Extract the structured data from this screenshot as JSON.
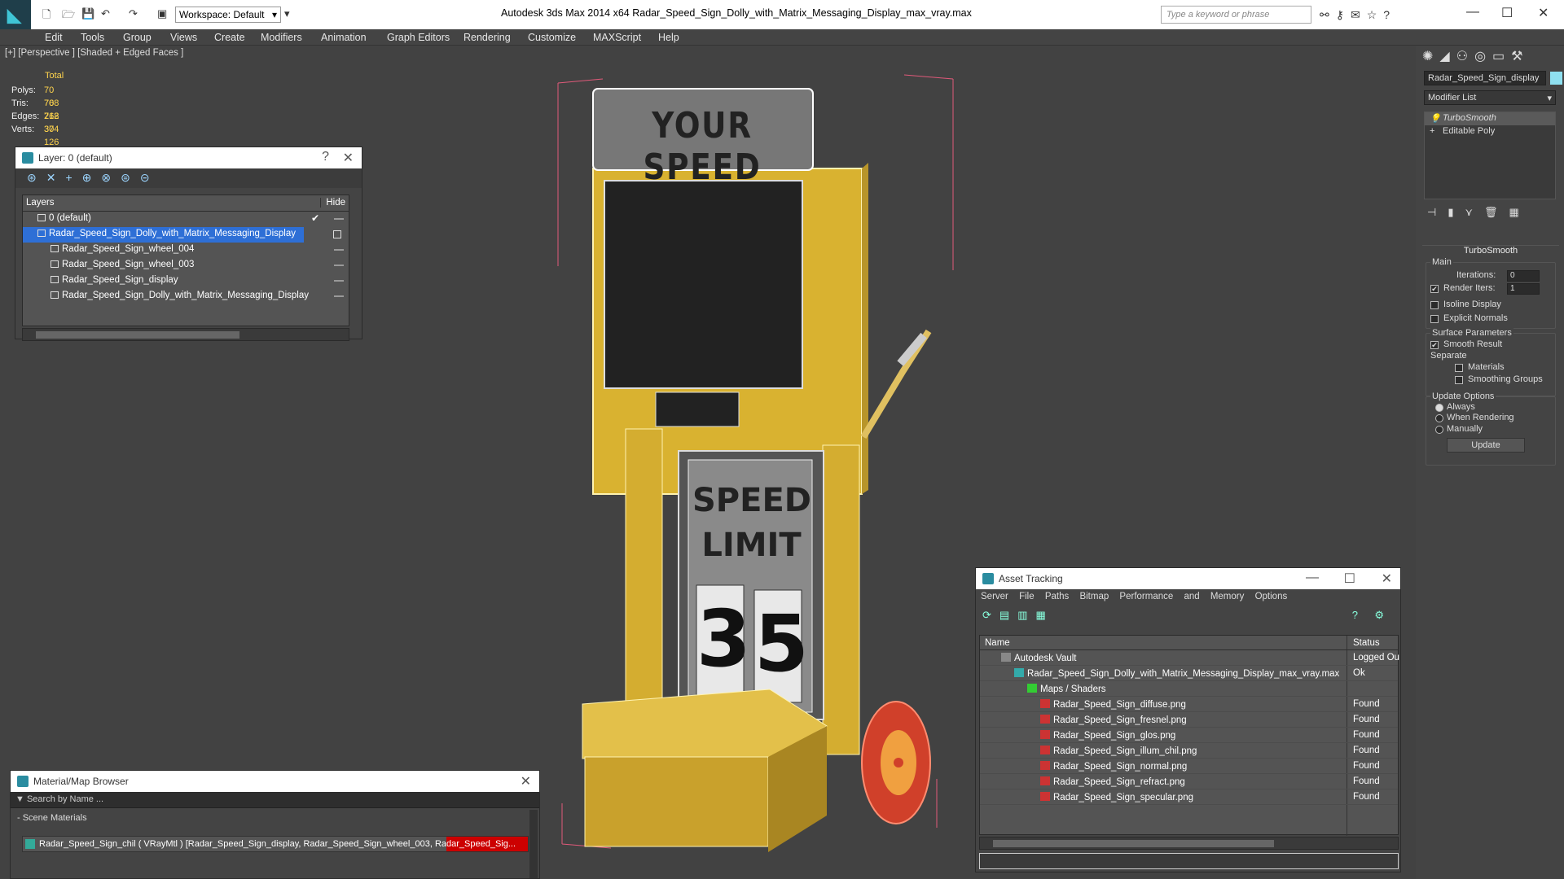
{
  "app": {
    "title": "Autodesk 3ds Max  2014 x64      Radar_Speed_Sign_Dolly_with_Matrix_Messaging_Display_max_vray.max",
    "workspace": "Workspace: Default",
    "search_placeholder": "Type a keyword or phrase"
  },
  "menu": [
    "Edit",
    "Tools",
    "Group",
    "Views",
    "Create",
    "Modifiers",
    "Animation",
    "Graph Editors",
    "Rendering",
    "Customize",
    "MAXScript",
    "Help"
  ],
  "viewport": {
    "label": "[+] [Perspective ] [Shaded + Edged Faces ]",
    "stats": {
      "total_label": "Total",
      "rows": [
        {
          "label": "Polys:",
          "value": "70 768"
        },
        {
          "label": "Tris:",
          "value": "70 768"
        },
        {
          "label": "Edges:",
          "value": "212 304"
        },
        {
          "label": "Verts:",
          "value": "37 126"
        }
      ]
    },
    "model": {
      "sign_top": "YOUR SPEED",
      "limit_line1": "SPEED",
      "limit_line2": "LIMIT",
      "digit1": "3",
      "digit2": "5"
    }
  },
  "layer_panel": {
    "title": "Layer: 0 (default)",
    "col_layers": "Layers",
    "col_hide": "Hide",
    "rows": [
      {
        "name": "0 (default)"
      },
      {
        "name": "Radar_Speed_Sign_Dolly_with_Matrix_Messaging_Display"
      },
      {
        "name": "Radar_Speed_Sign_wheel_004"
      },
      {
        "name": "Radar_Speed_Sign_wheel_003"
      },
      {
        "name": "Radar_Speed_Sign_display"
      },
      {
        "name": "Radar_Speed_Sign_Dolly_with_Matrix_Messaging_Display"
      }
    ]
  },
  "command_panel": {
    "object_name": "Radar_Speed_Sign_display",
    "modifier_list": "Modifier List",
    "stack": [
      "TurboSmooth",
      "Editable Poly"
    ],
    "rollout_title": "TurboSmooth",
    "main_label": "Main",
    "iterations_label": "Iterations:",
    "iterations_value": "0",
    "render_iters_label": "Render Iters:",
    "render_iters_value": "1",
    "isoline": "Isoline Display",
    "explicit_normals": "Explicit Normals",
    "surface_params": "Surface Parameters",
    "smooth_result": "Smooth Result",
    "separate": "Separate",
    "materials": "Materials",
    "smoothing_groups": "Smoothing Groups",
    "update_options": "Update Options",
    "always": "Always",
    "when_rendering": "When Rendering",
    "manually": "Manually",
    "update_button": "Update"
  },
  "asset_tracking": {
    "title": "Asset Tracking",
    "menu": [
      "Server",
      "File",
      "Paths",
      "Bitmap Performance and Memory",
      "Options"
    ],
    "col_name": "Name",
    "col_status": "Status",
    "rows": [
      {
        "name": "Autodesk Vault",
        "status": "Logged Ou"
      },
      {
        "name": "Radar_Speed_Sign_Dolly_with_Matrix_Messaging_Display_max_vray.max",
        "status": "Ok"
      },
      {
        "name": "Maps / Shaders",
        "status": ""
      },
      {
        "name": "Radar_Speed_Sign_diffuse.png",
        "status": "Found"
      },
      {
        "name": "Radar_Speed_Sign_fresnel.png",
        "status": "Found"
      },
      {
        "name": "Radar_Speed_Sign_glos.png",
        "status": "Found"
      },
      {
        "name": "Radar_Speed_Sign_illum_chil.png",
        "status": "Found"
      },
      {
        "name": "Radar_Speed_Sign_normal.png",
        "status": "Found"
      },
      {
        "name": "Radar_Speed_Sign_refract.png",
        "status": "Found"
      },
      {
        "name": "Radar_Speed_Sign_specular.png",
        "status": "Found"
      }
    ]
  },
  "material_browser": {
    "title": "Material/Map Browser",
    "search_placeholder": "Search by Name ...",
    "section": "- Scene Materials",
    "row": "Radar_Speed_Sign_chil ( VRayMtl ) [Radar_Speed_Sign_display, Radar_Speed_Sign_wheel_003, Radar_Speed_Sig..."
  }
}
